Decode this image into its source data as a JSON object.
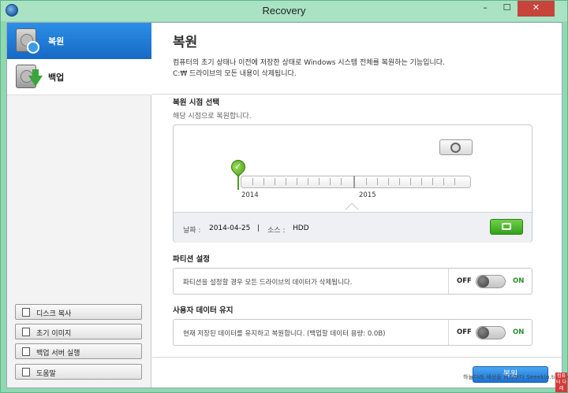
{
  "window": {
    "title": "Recovery",
    "buttons": {
      "minimize": "–",
      "maximize": "☐",
      "close": "✕"
    }
  },
  "sidebar": {
    "nav": [
      {
        "label": "복원",
        "icon": "restore-drive-icon",
        "selected": true
      },
      {
        "label": "백업",
        "icon": "backup-drive-icon",
        "selected": false
      }
    ],
    "buttons": [
      {
        "label": "디스크 복사",
        "icon": "disk-copy-icon"
      },
      {
        "label": "초기 이미지",
        "icon": "initial-image-icon"
      },
      {
        "label": "백업 서버 실행",
        "icon": "backup-server-icon"
      },
      {
        "label": "도움말",
        "icon": "help-icon"
      }
    ]
  },
  "main": {
    "title": "복원",
    "description_line1": "컴퓨터의 초기 상태나 이전에 저장한 상태로 Windows 시스템 전체를 복원하는 기능입니다.",
    "description_line2": "C:₩ 드라이브의 모든 내용이 삭제됩니다.",
    "restore_point": {
      "title": "복원 시점 선택",
      "subtitle": "해당 시점으로 복원합니다.",
      "years": [
        "2014",
        "2015"
      ],
      "date_label": "날짜 :",
      "date_value": "2014-04-25",
      "divider": "|",
      "source_label": "소스 :",
      "source_value": "HDD"
    },
    "partition": {
      "title": "파티션 설정",
      "text": "파티션을 설정할 경우 모든 드라이브의 데이터가 삭제됩니다.",
      "off_label": "OFF",
      "on_label": "ON",
      "state": "off"
    },
    "user_data": {
      "title": "사용자 데이터 유지",
      "text": "현재 저장된 데이터를 유지하고 복원합니다. (백업할 데이터 용량: 0.0B)",
      "off_label": "OFF",
      "on_label": "ON",
      "state": "off"
    },
    "primary_button": "복원"
  },
  "watermark": {
    "text": "하늘다래 세상을 바라보다  Seeeklu.tistory",
    "badge": "컴퓨터 다래"
  },
  "colors": {
    "accent": "#1a73d6",
    "selected_nav": "#2c8fe6",
    "on_green": "#2e8b2e",
    "frame": "#8fd8b0",
    "close": "#c7443a"
  }
}
